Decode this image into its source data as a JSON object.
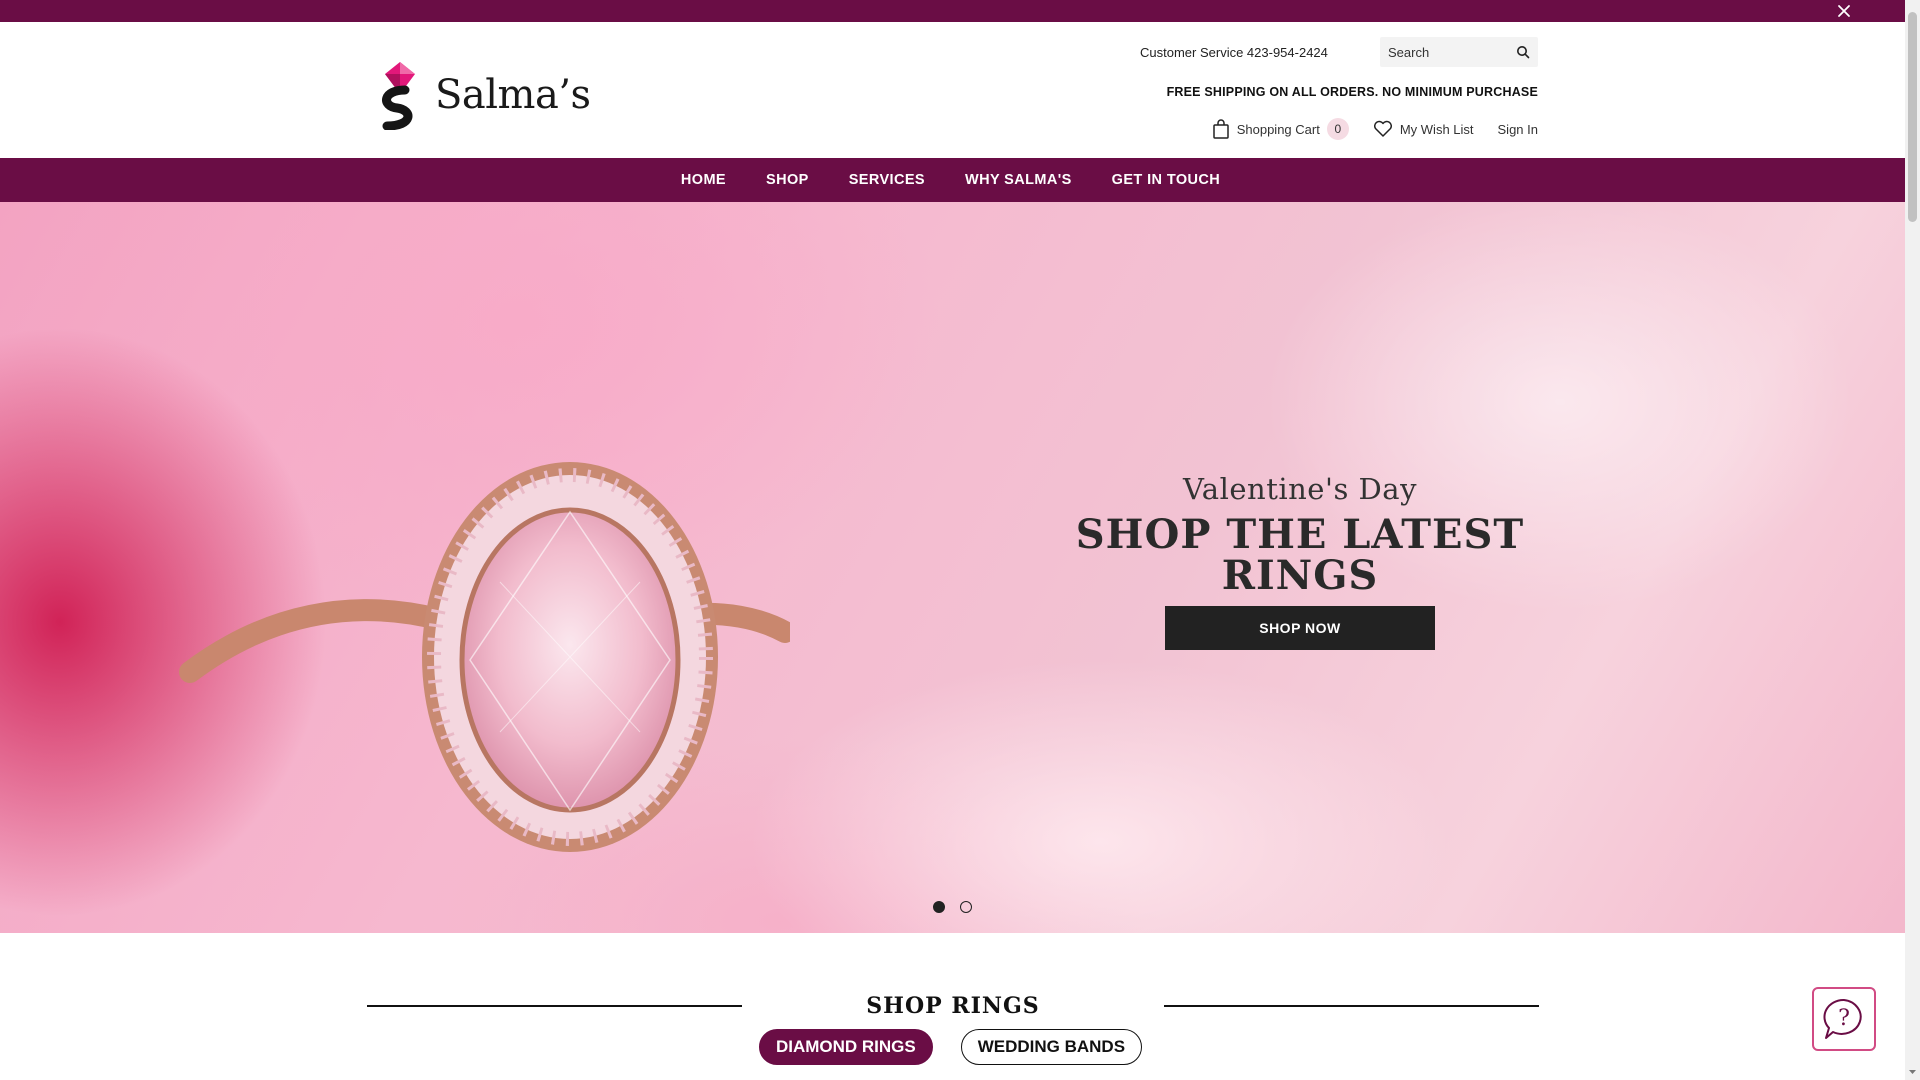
{
  "header": {
    "customer_service": "Customer Service 423-954-2424",
    "search_placeholder": "Search",
    "shipping_notice": "FREE SHIPPING ON ALL ORDERS. NO MINIMUM PURCHASE",
    "cart_label": "Shopping Cart",
    "cart_count": "0",
    "wishlist_label": "My Wish List",
    "signin_label": "Sign In",
    "logo_text": "Salma’s"
  },
  "nav": {
    "items": [
      "HOME",
      "SHOP",
      "SERVICES",
      "WHY SALMA'S",
      "GET IN TOUCH"
    ]
  },
  "hero": {
    "subtitle": "Valentine's Day",
    "title": "SHOP THE LATEST RINGS",
    "cta": "SHOP NOW",
    "slides": 2,
    "active_slide": 1
  },
  "section": {
    "title": "SHOP RINGS",
    "tabs": [
      "DIAMOND RINGS",
      "WEDDING BANDS"
    ],
    "active_tab": 0
  },
  "colors": {
    "brand_plum": "#6a0d45",
    "button_dark": "#222222",
    "help_pink": "#d14b84"
  },
  "icons": {
    "close": "close-icon",
    "search": "search-icon",
    "cart": "shopping-bag-icon",
    "wishlist": "heart-icon",
    "help": "question-chat-icon"
  }
}
